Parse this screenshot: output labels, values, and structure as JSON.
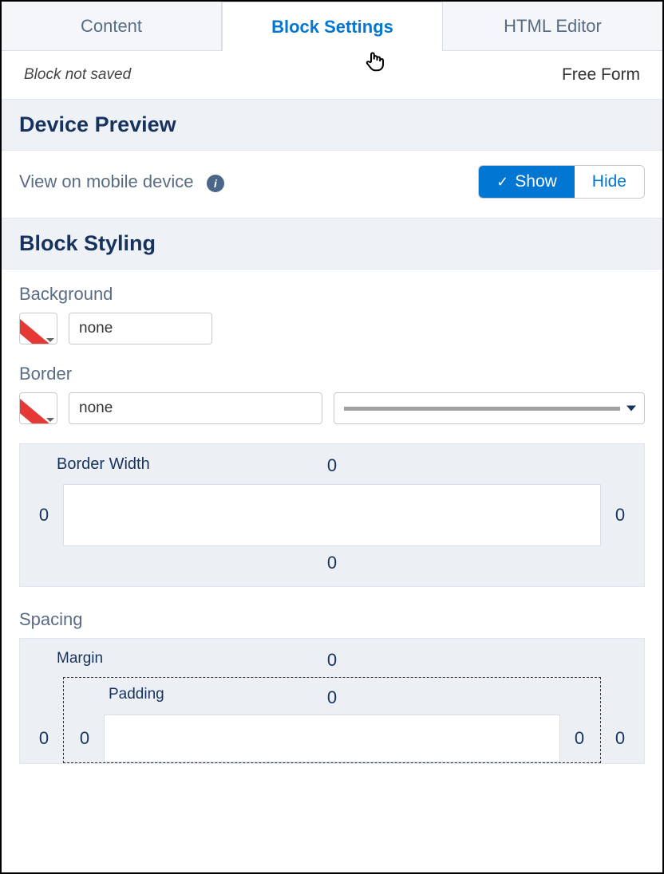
{
  "tabs": {
    "content": "Content",
    "block_settings": "Block Settings",
    "html_editor": "HTML Editor"
  },
  "status": {
    "not_saved": "Block not saved",
    "layout_type": "Free Form"
  },
  "sections": {
    "device_preview": "Device Preview",
    "block_styling": "Block Styling"
  },
  "device_preview": {
    "label": "View on mobile device",
    "show": "Show",
    "hide": "Hide"
  },
  "styling": {
    "background_label": "Background",
    "background_value": "none",
    "border_label": "Border",
    "border_value": "none",
    "border_width_label": "Border Width",
    "border_width": {
      "top": "0",
      "right": "0",
      "bottom": "0",
      "left": "0"
    },
    "spacing_label": "Spacing",
    "margin_label": "Margin",
    "margin": {
      "top": "0",
      "right": "0",
      "left": "0"
    },
    "padding_label": "Padding",
    "padding": {
      "top": "0",
      "right": "0",
      "left": "0"
    }
  }
}
